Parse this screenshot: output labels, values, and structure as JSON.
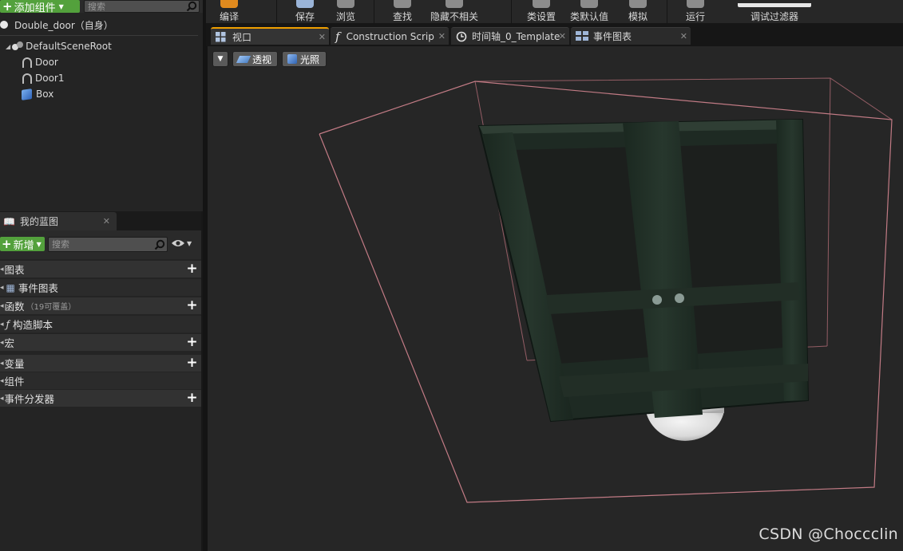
{
  "components_panel": {
    "add_component_label": "添加组件",
    "search_placeholder": "搜索",
    "self_item": "Double_door（自身）",
    "tree": [
      "DefaultSceneRoot",
      "Door",
      "Door1",
      "Box"
    ]
  },
  "blueprint_panel": {
    "tab_label": "我的蓝图",
    "new_label": "新增",
    "search_placeholder": "搜索",
    "rows": [
      {
        "label": "图表",
        "kind": "cat",
        "plus": true
      },
      {
        "label": "事件图表",
        "kind": "sub",
        "plus": false
      },
      {
        "label": "函数",
        "kind": "cat",
        "plus": true,
        "note": "（19可覆盖）"
      },
      {
        "label": "构造脚本",
        "kind": "sub",
        "plus": false
      },
      {
        "label": "宏",
        "kind": "cat",
        "plus": true
      },
      {
        "label": "变量",
        "kind": "cat",
        "plus": true
      },
      {
        "label": "组件",
        "kind": "sub",
        "plus": false
      },
      {
        "label": "事件分发器",
        "kind": "cat",
        "plus": true
      }
    ]
  },
  "toolbar": {
    "compile": "编译",
    "save": "保存",
    "browse": "浏览",
    "find": "查找",
    "hide_unrelated": "隐藏不相关",
    "class_settings": "类设置",
    "class_defaults": "类默认值",
    "simulate": "模拟",
    "play": "运行",
    "debug_filter": "调试过滤器"
  },
  "tabs": [
    {
      "label": "视口",
      "icon": "viewport-grid-icon",
      "active": true
    },
    {
      "label": "Construction Scrip",
      "icon": "function-icon",
      "active": false
    },
    {
      "label": "时间轴_0_Template",
      "icon": "clock-icon",
      "active": false
    },
    {
      "label": "事件图表",
      "icon": "graph-icon",
      "active": false
    }
  ],
  "viewport": {
    "perspective_label": "透视",
    "lit_label": "光照"
  },
  "watermark": "CSDN @Choccclin",
  "colors": {
    "accent_green": "#53a13c",
    "tab_accent": "#f0a000",
    "bounds_box": "#b9707a",
    "door_frame": "#1d2a22"
  }
}
